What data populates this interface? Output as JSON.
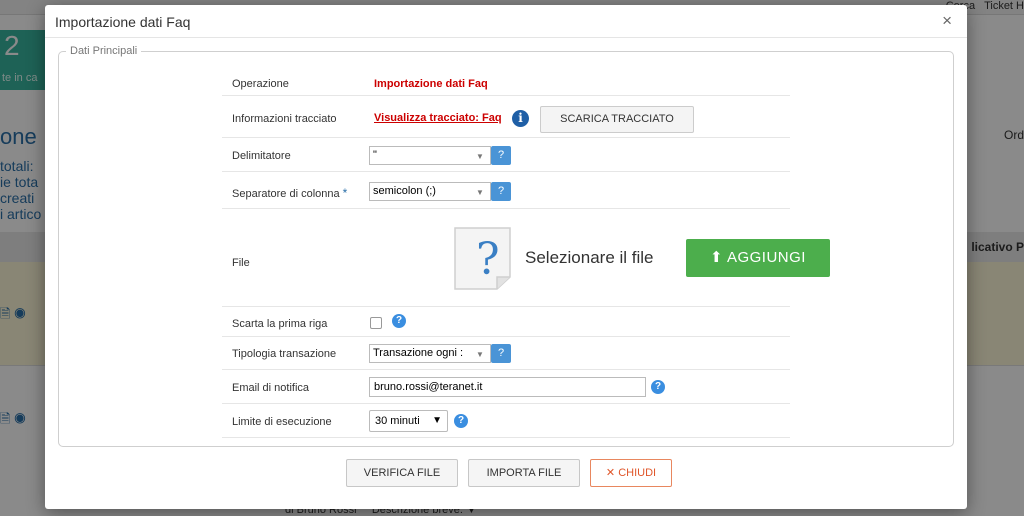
{
  "background": {
    "top_right_search": "Cerca",
    "top_right_ticket": "Ticket H",
    "left_number": "2",
    "left_sub": "te in ca",
    "big_title": "one",
    "side_lines": [
      "totali:",
      "ie tota",
      "creati",
      "i artico"
    ],
    "right_ord": "Ord",
    "right_applicativo": "licativo  P",
    "bottom_text": "Descrizione breve: ▼",
    "bottom_author": "di Bruno Rossi"
  },
  "modal": {
    "title": "Importazione dati Faq",
    "close_icon": "×",
    "legend": "Dati Principali",
    "rows": {
      "operazione": {
        "label": "Operazione",
        "value": "Importazione dati Faq"
      },
      "info_tracciato": {
        "label": "Informazioni tracciato",
        "link": "Visualizza tracciato: Faq",
        "info_icon": "i",
        "button": "SCARICA TRACCIATO"
      },
      "delimitatore": {
        "label": "Delimitatore",
        "value": "\"",
        "help": "?"
      },
      "separatore": {
        "label": "Separatore di colonna",
        "required": "*",
        "value": "semicolon (;)",
        "help": "?"
      },
      "file": {
        "label": "File",
        "icon_glyph": "?",
        "text": "Selezionare il file",
        "button": "AGGIUNGI",
        "button_icon": "⬆"
      },
      "scarta": {
        "label": "Scarta la prima riga",
        "checked": false,
        "help": "?"
      },
      "tipologia": {
        "label": "Tipologia transazione",
        "value": "Transazione ogni :",
        "help": "?"
      },
      "email": {
        "label": "Email di notifica",
        "value": "bruno.rossi@teranet.it",
        "help": "?"
      },
      "limite": {
        "label": "Limite di esecuzione",
        "value": "30 minuti",
        "caret": "▼",
        "help": "?"
      }
    },
    "footer": {
      "verifica": "VERIFICA FILE",
      "importa": "IMPORTA FILE",
      "chiudi": "CHIUDI",
      "chiudi_icon": "✕"
    }
  },
  "colors": {
    "required_red": "#cc0000",
    "help_blue": "#4a94d6",
    "add_green": "#4cae4c",
    "close_orange": "#e0562a"
  }
}
